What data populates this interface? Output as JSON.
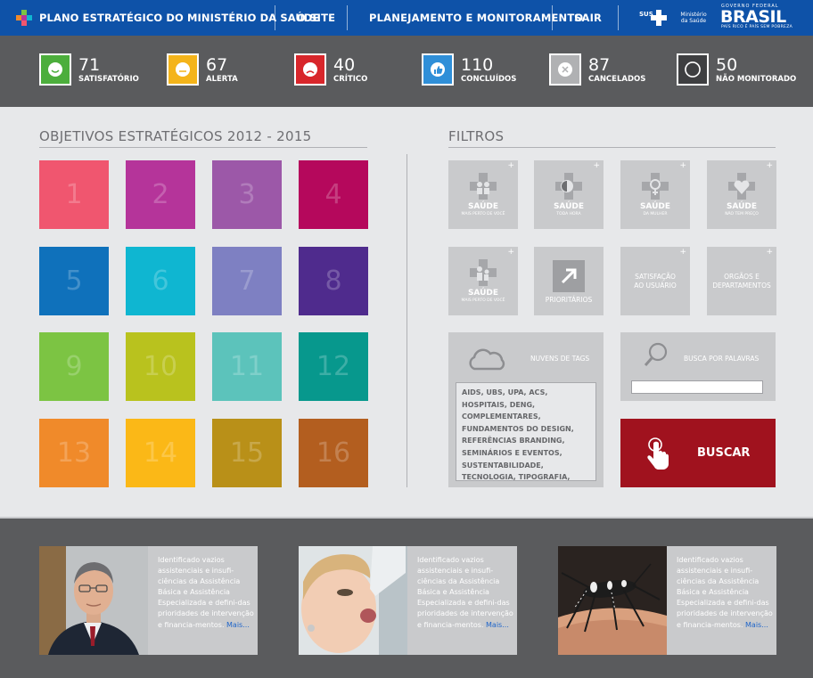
{
  "header": {
    "logo_icon": "colored-cross-logo-icon",
    "title": "PLANO ESTRATÉGICO DO MINISTÉRIO DA SAÚDE",
    "nav": [
      {
        "label": "O SITE"
      },
      {
        "label": "PLANEJAMENTO E MONITORAMENTO"
      },
      {
        "label": "SAIR"
      }
    ],
    "sus": "SUS",
    "ministerio": "Ministério da Saúde",
    "gov_top": "GOVERNO FEDERAL",
    "brasil": "BRASIL",
    "gov_tagline": "PAÍS RICO É PAÍS SEM POBREZA"
  },
  "status": [
    {
      "count": "71",
      "label": "SATISFATÓRIO",
      "color": "#4cae3c",
      "icon": "smile-icon"
    },
    {
      "count": "67",
      "label": "ALERTA",
      "color": "#f4b41a",
      "icon": "neutral-face-icon"
    },
    {
      "count": "40",
      "label": "CRÍTICO",
      "color": "#d8262b",
      "icon": "sad-face-icon"
    },
    {
      "count": "110",
      "label": "CONCLUÍDOS",
      "color": "#2f8fd8",
      "icon": "thumbs-up-icon"
    },
    {
      "count": "87",
      "label": "CANCELADOS",
      "color": "#b0b1b3",
      "icon": "x-circle-icon"
    },
    {
      "count": "50",
      "label": "NÃO MONITORADO",
      "color": "#3e3f41",
      "icon": "empty-circle-icon"
    }
  ],
  "objectives": {
    "title": "OBJETIVOS ESTRATÉGICOS 2012 - 2015",
    "tiles": [
      {
        "number": "1",
        "color": "#f0566f"
      },
      {
        "number": "2",
        "color": "#b5349a"
      },
      {
        "number": "3",
        "color": "#9c58a8"
      },
      {
        "number": "4",
        "color": "#b5085c"
      },
      {
        "number": "5",
        "color": "#0f71bb"
      },
      {
        "number": "6",
        "color": "#0fb6d1"
      },
      {
        "number": "7",
        "color": "#7e80c2"
      },
      {
        "number": "8",
        "color": "#4f2b8d"
      },
      {
        "number": "9",
        "color": "#7cc443"
      },
      {
        "number": "10",
        "color": "#b9c21e"
      },
      {
        "number": "11",
        "color": "#5cc3bb"
      },
      {
        "number": "12",
        "color": "#07988d"
      },
      {
        "number": "13",
        "color": "#f08a2a"
      },
      {
        "number": "14",
        "color": "#fbb817"
      },
      {
        "number": "15",
        "color": "#b99018"
      },
      {
        "number": "16",
        "color": "#b35e1f"
      }
    ]
  },
  "filters": {
    "title": "FILTROS",
    "programs": [
      {
        "name": "SAÚDE",
        "sub": "MAIS PERTO DE VOCÊ",
        "icon": "cross-people-icon"
      },
      {
        "name": "SAÚDE",
        "sub": "TODA HORA",
        "icon": "cross-clock-icon"
      },
      {
        "name": "SAÚDE",
        "sub": "DA MULHER",
        "icon": "cross-female-icon"
      },
      {
        "name": "SAÚDE",
        "sub": "NÃO TEM PREÇO",
        "icon": "cross-heart-icon"
      },
      {
        "name": "SAÚDE",
        "sub": "MAIS PERTO DE VOCÊ",
        "icon": "cross-family-icon"
      }
    ],
    "prioritarios": {
      "label": "PRIORITÁRIOS",
      "icon": "arrow-box-icon"
    },
    "satisfacao": "SATISFAÇÃO AO USUÁRIO",
    "orgaos": "ORGÃOS E DEPARTAMENTOS",
    "tags": {
      "label": "NUVENS DE TAGS",
      "icon": "cloud-icon",
      "text": "AIDS, UBS, UPA, ACS, HOSPITAIS, DENG, COMPLEMENTARES, FUNDAMENTOS DO DESIGN, REFERÊNCIAS BRANDING, SEMINÁRIOS E EVENTOS, SUSTENTABILIDADE, TECNOLOGIA, TIPOGRAFIA,"
    },
    "search": {
      "label": "BUSCA POR PALAVRAS",
      "icon": "magnifier-icon",
      "value": ""
    },
    "buscar": {
      "label": "BUSCAR",
      "icon": "hand-pointer-icon"
    }
  },
  "news": [
    {
      "image": "man-in-suit-photo",
      "text": "Identificado vazios assistenciais e insufi-ciências da Assistência Básica e Assistência Especializada e defini-das prioridades de intervenção e financia-mentos.",
      "more": "Mais..."
    },
    {
      "image": "child-vaccine-photo",
      "text": "Identificado vazios assistenciais e insufi-ciências da Assistência Básica e Assistência Especializada e defini-das prioridades de intervenção e financia-mentos.",
      "more": "Mais..."
    },
    {
      "image": "mosquito-photo",
      "text": "Identificado vazios assistenciais e insufi-ciências da Assistência Básica e Assistência Especializada e defini-das prioridades de intervenção e financia-mentos.",
      "more": "Mais..."
    }
  ]
}
